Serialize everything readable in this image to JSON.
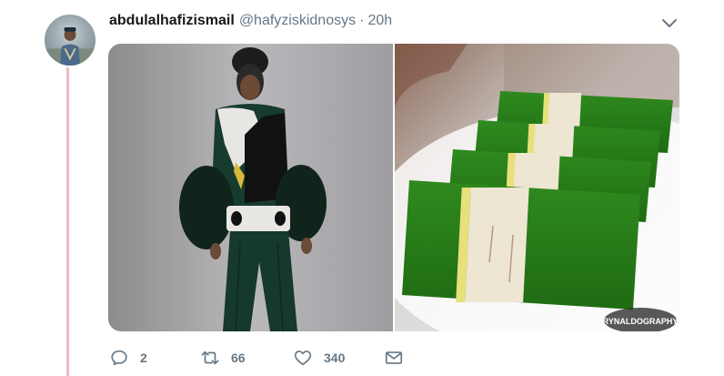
{
  "tweet": {
    "display_name": "abdulalhafizismail",
    "handle": "@hafyziskidnosys",
    "separator": "·",
    "time": "20h"
  },
  "icons": {
    "caret": "chevron-down-icon",
    "reply": "reply-icon",
    "retweet": "retweet-icon",
    "like": "heart-icon",
    "dm": "envelope-icon"
  },
  "actions": {
    "reply_count": "2",
    "retweet_count": "66",
    "like_count": "340"
  },
  "media": {
    "watermark": "RYNALDOGRAPHY"
  },
  "colors": {
    "thread_line": "#f5b8c4",
    "icon_gray": "#657786",
    "text_primary": "#14171a"
  }
}
